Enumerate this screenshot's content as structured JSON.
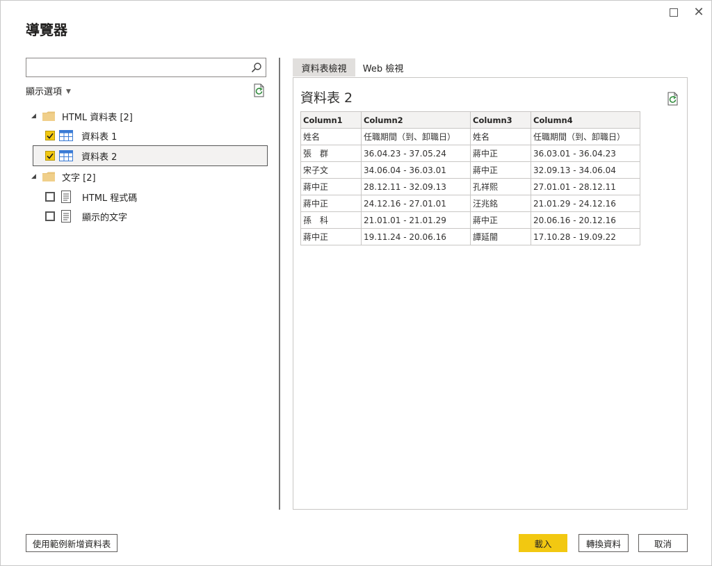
{
  "window": {
    "title": "導覽器"
  },
  "search": {
    "value": "",
    "placeholder": ""
  },
  "display_options": {
    "label": "顯示選項"
  },
  "tree": {
    "folders": [
      {
        "label": "HTML 資料表 [2]",
        "expanded": true,
        "items": [
          {
            "label": "資料表 1",
            "checked": true,
            "icon": "table-icon"
          },
          {
            "label": "資料表 2",
            "checked": true,
            "icon": "table-icon",
            "selected": true
          }
        ]
      },
      {
        "label": "文字 [2]",
        "expanded": true,
        "items": [
          {
            "label": "HTML 程式碼",
            "checked": false,
            "icon": "text-doc-icon"
          },
          {
            "label": "顯示的文字",
            "checked": false,
            "icon": "text-doc-icon"
          }
        ]
      }
    ]
  },
  "tabs": [
    {
      "label": "資料表檢視",
      "active": true
    },
    {
      "label": "Web 檢視",
      "active": false
    }
  ],
  "preview": {
    "title": "資料表 2",
    "columns": [
      "Column1",
      "Column2",
      "Column3",
      "Column4"
    ],
    "rows": [
      [
        "姓名",
        "任職期間（到、卸職日）",
        "姓名",
        "任職期間（到、卸職日）"
      ],
      [
        "張　群",
        "36.04.23 - 37.05.24",
        "蔣中正",
        "36.03.01 - 36.04.23"
      ],
      [
        "宋子文",
        "34.06.04 - 36.03.01",
        "蔣中正",
        "32.09.13 - 34.06.04"
      ],
      [
        "蔣中正",
        "28.12.11 - 32.09.13",
        "孔祥熙",
        "27.01.01 - 28.12.11"
      ],
      [
        "蔣中正",
        "24.12.16 - 27.01.01",
        "汪兆銘",
        "21.01.29 - 24.12.16"
      ],
      [
        "孫　科",
        "21.01.01 - 21.01.29",
        "蔣中正",
        "20.06.16 - 20.12.16"
      ],
      [
        "蔣中正",
        "19.11.24 - 20.06.16",
        "譚延闓",
        "17.10.28 - 19.09.22"
      ]
    ]
  },
  "buttons": {
    "sample": "使用範例新增資料表",
    "load": "載入",
    "transform": "轉換資料",
    "cancel": "取消"
  },
  "colors": {
    "accent": "#f2c811",
    "folder": "#e8c47a",
    "table_icon": "#3a7bd5"
  }
}
